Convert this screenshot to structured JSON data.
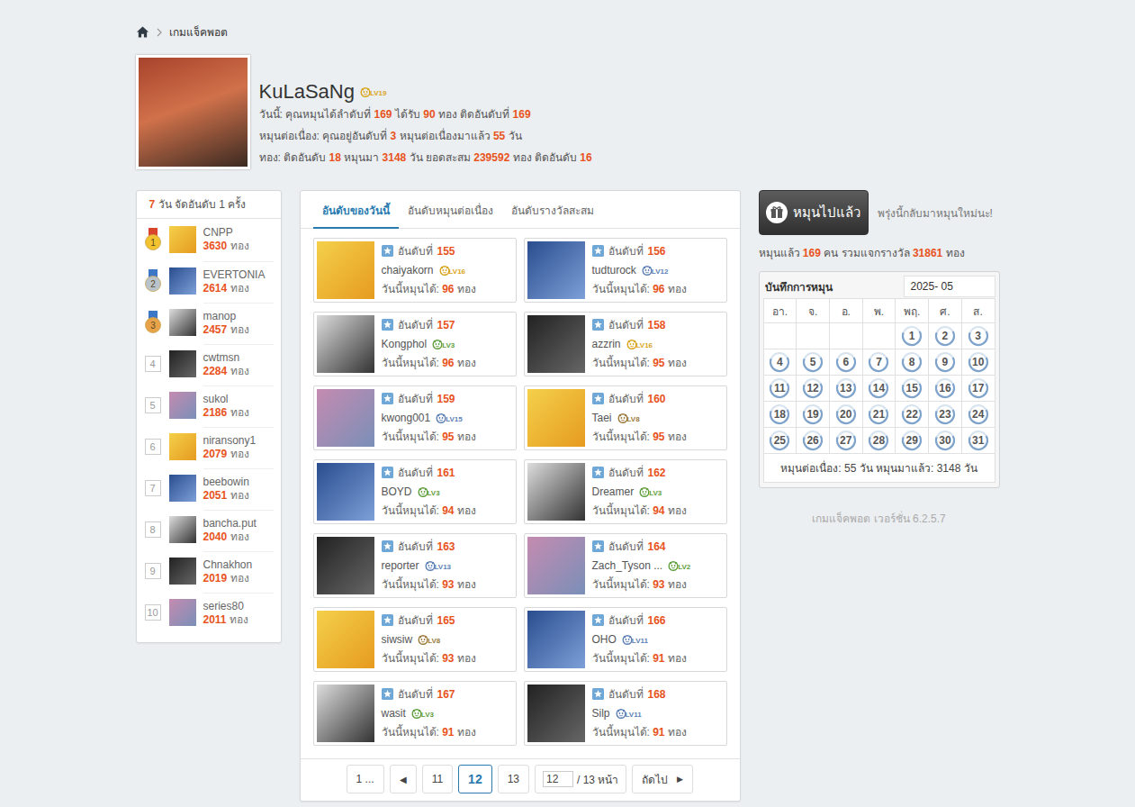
{
  "breadcrumb": {
    "label": "เกมแจ็คพอต"
  },
  "profile": {
    "name": "KuLaSaNg",
    "level": "LV19",
    "level_color": "#d9a41b",
    "lines": [
      [
        {
          "text": "วันนี้: คุณหมุนได้ลำดับที่ ",
          "highlight": false
        },
        {
          "text": "169",
          "highlight": true
        },
        {
          "text": " ได้รับ ",
          "highlight": false
        },
        {
          "text": "90",
          "highlight": true
        },
        {
          "text": " ทอง ติดอันดับที่ ",
          "highlight": false
        },
        {
          "text": "169",
          "highlight": true
        }
      ],
      [
        {
          "text": "หมุนต่อเนื่อง: คุณอยู่อันดับที่ ",
          "highlight": false
        },
        {
          "text": "3",
          "highlight": true
        },
        {
          "text": " หมุนต่อเนื่องมาแล้ว ",
          "highlight": false
        },
        {
          "text": "55",
          "highlight": true
        },
        {
          "text": " วัน",
          "highlight": false
        }
      ],
      [
        {
          "text": "ทอง: ติดอันดับ ",
          "highlight": false
        },
        {
          "text": "18",
          "highlight": true
        },
        {
          "text": " หมุนมา ",
          "highlight": false
        },
        {
          "text": "3148",
          "highlight": true
        },
        {
          "text": " วัน ยอดสะสม ",
          "highlight": false
        },
        {
          "text": "239592",
          "highlight": true
        },
        {
          "text": " ทอง ติดอันดับ ",
          "highlight": false
        },
        {
          "text": "16",
          "highlight": true
        }
      ]
    ]
  },
  "leaderboard": {
    "header": [
      {
        "text": "7",
        "highlight": true
      },
      {
        "text": " วัน จัดอันดับ 1 ครั้ง",
        "highlight": false
      }
    ],
    "gold_unit": "ทอง",
    "items": [
      {
        "rank": "1",
        "kind": "medal",
        "color": "#f2c230",
        "name": "CNPP",
        "gold": "3630"
      },
      {
        "rank": "2",
        "kind": "medal",
        "color": "#b9c3cc",
        "name": "EVERTONIA",
        "gold": "2614"
      },
      {
        "rank": "3",
        "kind": "medal",
        "color": "#e8a24a",
        "name": "manop",
        "gold": "2457"
      },
      {
        "rank": "4",
        "kind": "plain",
        "color": "#999999",
        "name": "cwtmsn",
        "gold": "2284"
      },
      {
        "rank": "5",
        "kind": "plain",
        "color": "#999999",
        "name": "sukol",
        "gold": "2186"
      },
      {
        "rank": "6",
        "kind": "plain",
        "color": "#999999",
        "name": "niransony1",
        "gold": "2079"
      },
      {
        "rank": "7",
        "kind": "plain",
        "color": "#999999",
        "name": "beebowin",
        "gold": "2051"
      },
      {
        "rank": "8",
        "kind": "plain",
        "color": "#999999",
        "name": "bancha.put",
        "gold": "2040"
      },
      {
        "rank": "9",
        "kind": "plain",
        "color": "#999999",
        "name": "Chnakhon",
        "gold": "2019"
      },
      {
        "rank": "10",
        "kind": "plain",
        "color": "#999999",
        "name": "series80",
        "gold": "2011"
      }
    ]
  },
  "tabs": [
    {
      "label": "อันดับของวันนี้",
      "selected": true
    },
    {
      "label": "อันดับหมุนต่อเนื่อง",
      "selected": false
    },
    {
      "label": "อันดับรางวัลสะสม",
      "selected": false
    }
  ],
  "cards": {
    "rank_prefix": "อันดับที่",
    "today_label": "วันนี้หมุนได้:",
    "unit": "ทอง",
    "items": [
      {
        "rank": "155",
        "name": "chaiyakorn",
        "level": "LV16",
        "color": "#d9a41b",
        "gold": "96"
      },
      {
        "rank": "156",
        "name": "tudturock",
        "level": "LV12",
        "color": "#5b7fb5",
        "gold": "96"
      },
      {
        "rank": "157",
        "name": "Kongphol",
        "level": "LV3",
        "color": "#5e9e3c",
        "gold": "96"
      },
      {
        "rank": "158",
        "name": "azzrin",
        "level": "LV16",
        "color": "#d9a41b",
        "gold": "95"
      },
      {
        "rank": "159",
        "name": "kwong001",
        "level": "LV15",
        "color": "#5b7fb5",
        "gold": "95"
      },
      {
        "rank": "160",
        "name": "Taei",
        "level": "LV8",
        "color": "#9a7a3a",
        "gold": "95"
      },
      {
        "rank": "161",
        "name": "BOYD",
        "level": "LV3",
        "color": "#5e9e3c",
        "gold": "94"
      },
      {
        "rank": "162",
        "name": "Dreamer",
        "level": "LV3",
        "color": "#5e9e3c",
        "gold": "94"
      },
      {
        "rank": "163",
        "name": "reporter",
        "level": "LV13",
        "color": "#5b7fb5",
        "gold": "93"
      },
      {
        "rank": "164",
        "name": "Zach_Tyson ...",
        "level": "LV2",
        "color": "#5e9e3c",
        "gold": "93"
      },
      {
        "rank": "165",
        "name": "siwsiw",
        "level": "LV8",
        "color": "#9a7a3a",
        "gold": "93"
      },
      {
        "rank": "166",
        "name": "OHO",
        "level": "LV11",
        "color": "#5b7fb5",
        "gold": "91"
      },
      {
        "rank": "167",
        "name": "wasit",
        "level": "LV3",
        "color": "#5e9e3c",
        "gold": "91"
      },
      {
        "rank": "168",
        "name": "Silp",
        "level": "LV11",
        "color": "#5b7fb5",
        "gold": "91"
      }
    ]
  },
  "pagination": {
    "items": [
      {
        "kind": "page",
        "label": "1 ...",
        "selected": false
      },
      {
        "kind": "arrow",
        "label": "◀",
        "selected": false
      },
      {
        "kind": "page",
        "label": "11",
        "selected": false
      },
      {
        "kind": "page",
        "label": "12",
        "selected": true
      },
      {
        "kind": "page",
        "label": "13",
        "selected": false
      }
    ],
    "jump": {
      "value": "12",
      "suffix": "/ 13 หน้า"
    },
    "next": {
      "label": "ถัดไป",
      "arrow": "▶"
    }
  },
  "spin": {
    "label": "หมุนไปแล้ว",
    "disabled": true,
    "note": "พรุ่งนี้กลับมาหมุนใหม่นะ!"
  },
  "stats": [
    {
      "text": "หมุนแล้ว ",
      "highlight": false
    },
    {
      "text": "169",
      "highlight": true
    },
    {
      "text": " คน รวมแจกรางวัล ",
      "highlight": false
    },
    {
      "text": "31861",
      "highlight": true
    },
    {
      "text": " ทอง",
      "highlight": false
    }
  ],
  "calendar": {
    "title": "บันทึกการหมุน",
    "month": "2025- 05",
    "weekdays": [
      "อา.",
      "จ.",
      "อ.",
      "พ.",
      "พฤ.",
      "ศ.",
      "ส."
    ],
    "days": [
      {
        "label": "",
        "spun": false
      },
      {
        "label": "",
        "spun": false
      },
      {
        "label": "",
        "spun": false
      },
      {
        "label": "",
        "spun": false
      },
      {
        "label": "1",
        "spun": true
      },
      {
        "label": "2",
        "spun": true
      },
      {
        "label": "3",
        "spun": true
      },
      {
        "label": "4",
        "spun": true
      },
      {
        "label": "5",
        "spun": true
      },
      {
        "label": "6",
        "spun": true
      },
      {
        "label": "7",
        "spun": true
      },
      {
        "label": "8",
        "spun": true
      },
      {
        "label": "9",
        "spun": true
      },
      {
        "label": "10",
        "spun": true
      },
      {
        "label": "11",
        "spun": true
      },
      {
        "label": "12",
        "spun": true
      },
      {
        "label": "13",
        "spun": true
      },
      {
        "label": "14",
        "spun": true
      },
      {
        "label": "15",
        "spun": true
      },
      {
        "label": "16",
        "spun": true
      },
      {
        "label": "17",
        "spun": true
      },
      {
        "label": "18",
        "spun": true
      },
      {
        "label": "19",
        "spun": true
      },
      {
        "label": "20",
        "spun": true
      },
      {
        "label": "21",
        "spun": true
      },
      {
        "label": "22",
        "spun": true
      },
      {
        "label": "23",
        "spun": true
      },
      {
        "label": "24",
        "spun": true
      },
      {
        "label": "25",
        "spun": true
      },
      {
        "label": "26",
        "spun": true
      },
      {
        "label": "27",
        "spun": true
      },
      {
        "label": "28",
        "spun": true
      },
      {
        "label": "29",
        "spun": true
      },
      {
        "label": "30",
        "spun": true
      },
      {
        "label": "31",
        "spun": true
      }
    ],
    "footer": "หมุนต่อเนื่อง: 55 วัน หมุนมาแล้ว: 3148 วัน"
  },
  "version": "เกมแจ็คพอต เวอร์ชั่น 6.2.5.7"
}
